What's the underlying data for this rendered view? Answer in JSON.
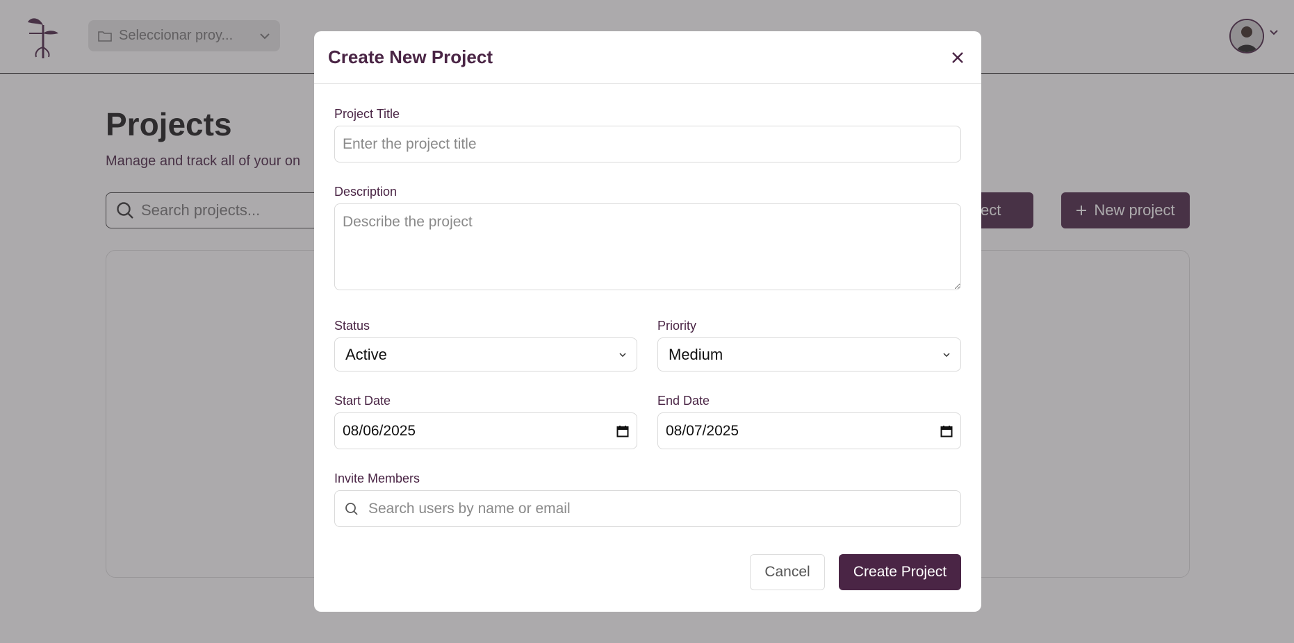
{
  "header": {
    "project_selector": "Seleccionar proy...",
    "folder_icon": "folder-icon",
    "chevron_icon": "chevron-down-icon"
  },
  "page": {
    "title": "Projects",
    "subtitle": "Manage and track all of your on",
    "search_placeholder": "Search projects...",
    "join_button": "roject",
    "new_button": "New project"
  },
  "modal": {
    "title": "Create New Project",
    "project_title_label": "Project Title",
    "project_title_placeholder": "Enter the project title",
    "description_label": "Description",
    "description_placeholder": "Describe the project",
    "status_label": "Status",
    "status_value": "Active",
    "priority_label": "Priority",
    "priority_value": "Medium",
    "start_date_label": "Start Date",
    "start_date_value": "08/06/2025",
    "end_date_label": "End Date",
    "end_date_value": "08/07/2025",
    "invite_label": "Invite Members",
    "invite_placeholder": "Search users by name or email",
    "cancel_label": "Cancel",
    "create_label": "Create Project"
  },
  "colors": {
    "brand": "#4a2545",
    "overlay": "#46424873"
  }
}
